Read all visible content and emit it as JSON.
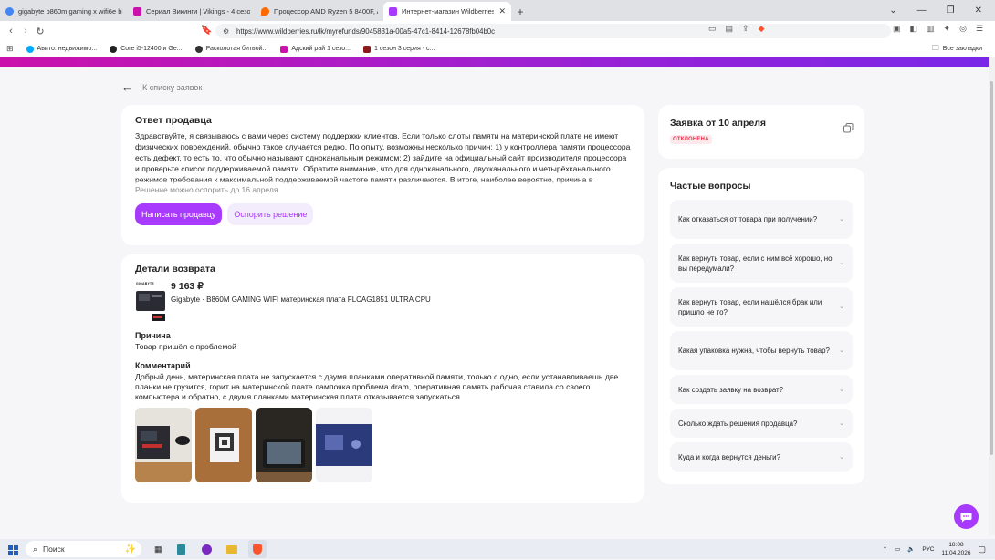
{
  "browser": {
    "tabs": [
      {
        "label": "gigabyte b860m gaming x wifi6e bio",
        "color": "#4285f4"
      },
      {
        "label": "Сериал Викинги | Vikings - 4 сезон",
        "color": "#cb11ab"
      },
      {
        "label": "Процессор AMD Ryzen 5 8400F, AM",
        "color": "#ff6a00"
      },
      {
        "label": "Интернет-магазин Wildberries",
        "color": "#a73afd"
      }
    ],
    "url": "https://www.wildberries.ru/lk/myrefunds/9045831a-00a5-47c1-8414-12678fb04b0c",
    "bookmarks": [
      "Авито: недвижимо...",
      "Core i5-12400 и Ge...",
      "Расколотая битвой...",
      "Адский рай 1 сезо...",
      "1 сезон 3 серия - с..."
    ],
    "all_bookmarks": "Все закладки"
  },
  "page": {
    "back_label": "К списку заявок",
    "seller_answer": {
      "title": "Ответ продавца",
      "text": "Здравствуйте, я связываюсь с вами через систему поддержки клиентов. Если только слоты памяти на материнской плате не имеют физических повреждений, обычно такое случается редко. По опыту, возможны несколько причин: 1) у контроллера памяти процессора есть дефект, то есть то, что обычно называют одноканальным режимом; 2) зайдите на официальный сайт производителя процессора и проверьте список поддерживаемой памяти. Обратите внимание, что для одноканального, двухканального и четырёхканального режимов требования к максимальной поддерживаемой частоте памяти различаются. В итоге, наиболее вероятно, причина в процессоре или памяти",
      "dispute_until": "Решение можно оспорить до 16 апреля",
      "write_button": "Написать продавцу",
      "dispute_button": "Оспорить решение"
    },
    "return_details": {
      "title": "Детали возврата",
      "price": "9 163 ₽",
      "product_name": "Gigabyte · B860M GAMING WIFI материнская плата FLCAG1851 ULTRA CPU",
      "brand_mark": "GIGABYTE",
      "reason_label": "Причина",
      "reason_value": "Товар пришёл с проблемой",
      "comment_label": "Комментарий",
      "comment_value": "Добрый день, материнская плата не запускается с двумя планками оперативной памяти, только с одно, если устанавливаешь две планки не грузится, горит на материнской плате лампочка проблема dram, оперативная память рабочая ставила со своего компьютера и обратно, с двумя планками материнская плата отказывается запускаться"
    },
    "claim": {
      "title": "Заявка от 10 апреля",
      "status": "ОТКЛОНЕНА"
    },
    "faq": {
      "title": "Частые вопросы",
      "questions": [
        "Как отказаться от товара при получении?",
        "Как вернуть товар, если с ним всё хорошо, но вы передумали?",
        "Как вернуть товар, если нашёлся брак или пришло не то?",
        "Какая упаковка нужна, чтобы вернуть товар?",
        "Как создать заявку на возврат?",
        "Сколько ждать решения продавца?",
        "Куда и когда вернутся деньги?"
      ]
    }
  },
  "taskbar": {
    "search_label": "Поиск",
    "lang": "РУС",
    "time": "18:08",
    "date": "11.04.2026"
  },
  "colors": {
    "accent": "#a73afd",
    "reject": "#e8304c"
  }
}
